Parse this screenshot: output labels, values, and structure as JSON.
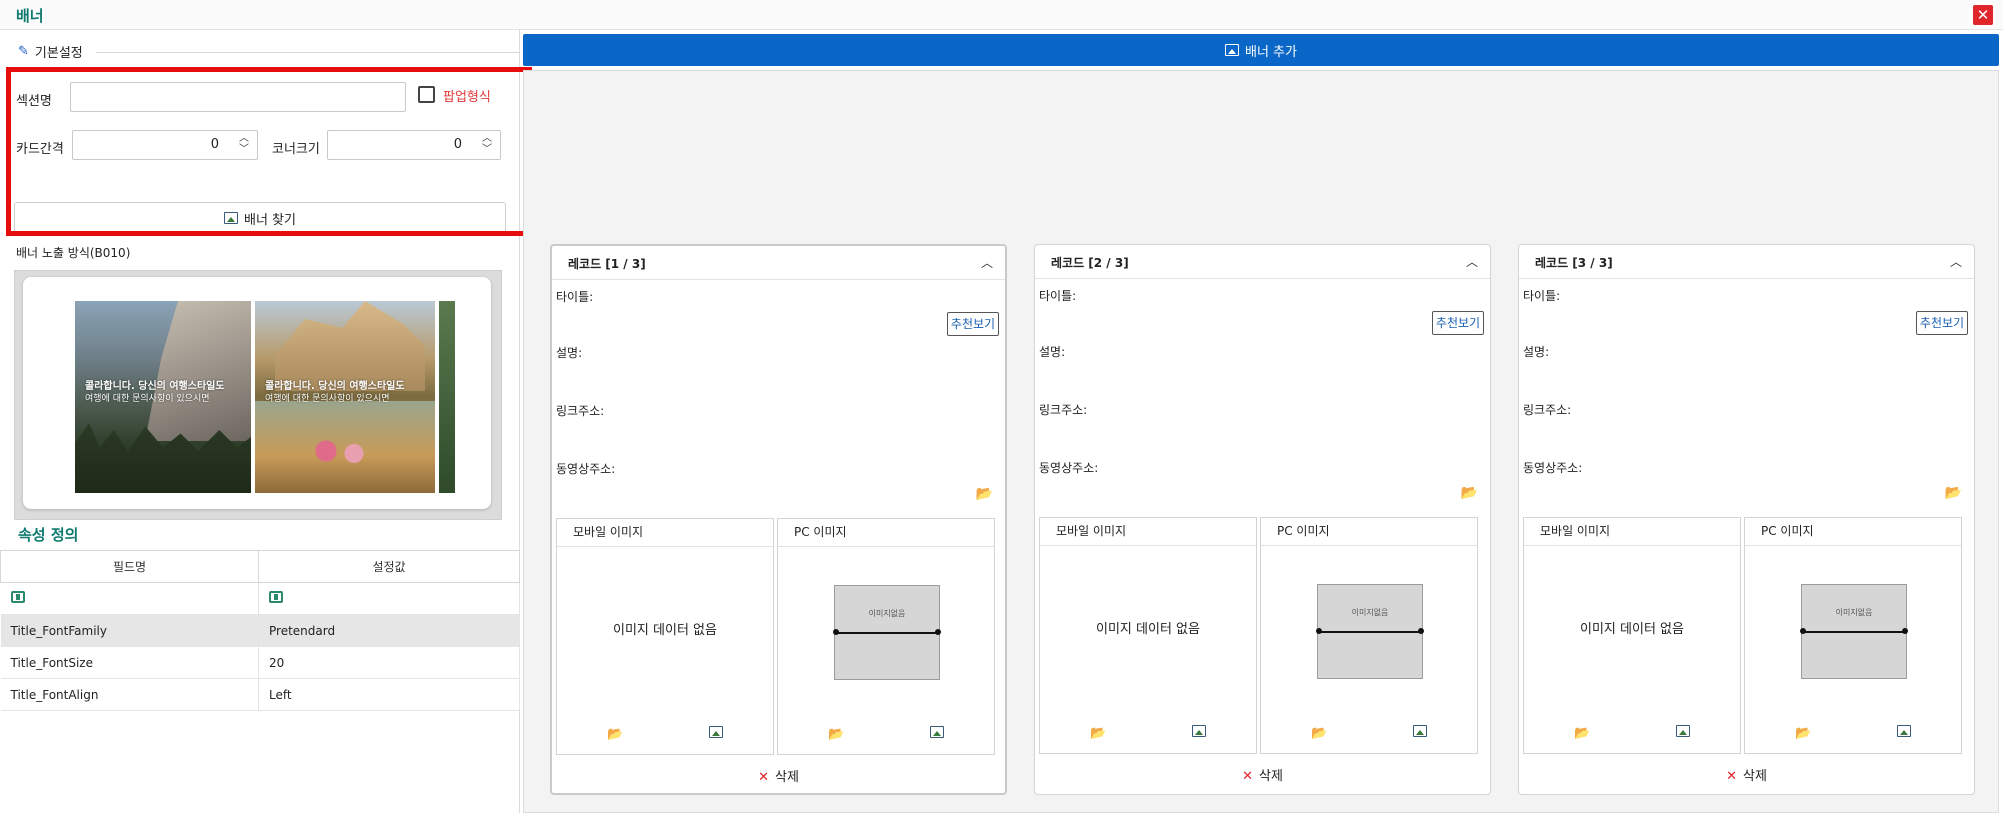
{
  "window": {
    "title": "배너",
    "close_symbol": "✕"
  },
  "basic": {
    "legend": "기본설정",
    "section_label": "섹션명",
    "section_value": "",
    "popup_label": "팝업형식",
    "card_gap_label": "카드간격",
    "card_gap_value": "0",
    "corner_label": "코너크기",
    "corner_value": "0",
    "find_banner": "배너 찾기",
    "mode_label": "배너 노출 방식(B010)"
  },
  "preview": {
    "slide1_title": "콜라합니다. 당신의 여행스타일도",
    "slide1_sub": "여행에 대한 문의사항이 있으시면",
    "slide2_title": "콜라합니다. 당신의 여행스타일도",
    "slide2_sub": "여행에 대한 문의사항이 있으시면"
  },
  "properties": {
    "title": "속성 정의",
    "headers": [
      "필드명",
      "설정값"
    ],
    "rows": [
      {
        "field": "Title_FontFamily",
        "value": "Pretendard"
      },
      {
        "field": "Title_FontSize",
        "value": "20"
      },
      {
        "field": "Title_FontAlign",
        "value": "Left"
      }
    ]
  },
  "right": {
    "add_banner": "배너 추가",
    "records": [
      {
        "header": "레코드 [1 / 3]"
      },
      {
        "header": "레코드 [2 / 3]"
      },
      {
        "header": "레코드 [3 / 3]"
      }
    ],
    "labels": {
      "title": "타이틀:",
      "desc": "설명:",
      "link": "링크주소:",
      "video": "동영상주소:",
      "recommend": "추천보기",
      "mobile_image": "모바일 이미지",
      "pc_image": "PC 이미지",
      "no_image": "이미지 데이터 없음",
      "placeholder_text": "이미지없음",
      "delete": "삭제"
    }
  },
  "colors": {
    "accent": "#0a67c7",
    "title": "#0f7a70",
    "highlight": "#e80d0d",
    "danger": "#e0252b"
  }
}
